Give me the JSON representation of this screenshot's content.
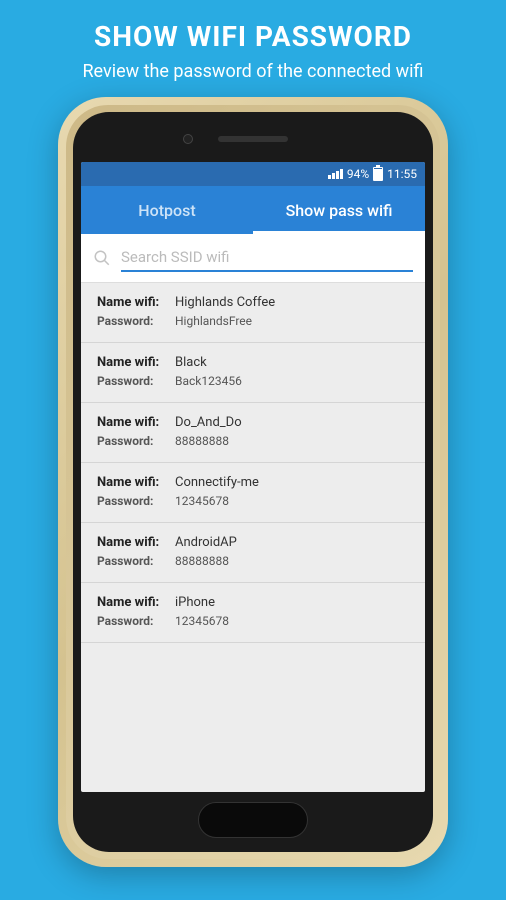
{
  "header": {
    "title": "SHOW WIFI PASSWORD",
    "subtitle": "Review the password of the connected wifi"
  },
  "statusbar": {
    "battery_pct": "94%",
    "time": "11:55"
  },
  "tabs": {
    "hotspot_label": "Hotpost",
    "showpass_label": "Show pass wifi"
  },
  "search": {
    "placeholder": "Search SSID wifi",
    "value": ""
  },
  "labels": {
    "name": "Name wifi:",
    "password": "Password:"
  },
  "items": [
    {
      "name": "Highlands Coffee",
      "password": "HighlandsFree"
    },
    {
      "name": "Black",
      "password": "Back123456"
    },
    {
      "name": "Do_And_Do",
      "password": "88888888"
    },
    {
      "name": "Connectify-me",
      "password": "12345678"
    },
    {
      "name": "AndroidAP",
      "password": "88888888"
    },
    {
      "name": "iPhone",
      "password": "12345678"
    }
  ]
}
